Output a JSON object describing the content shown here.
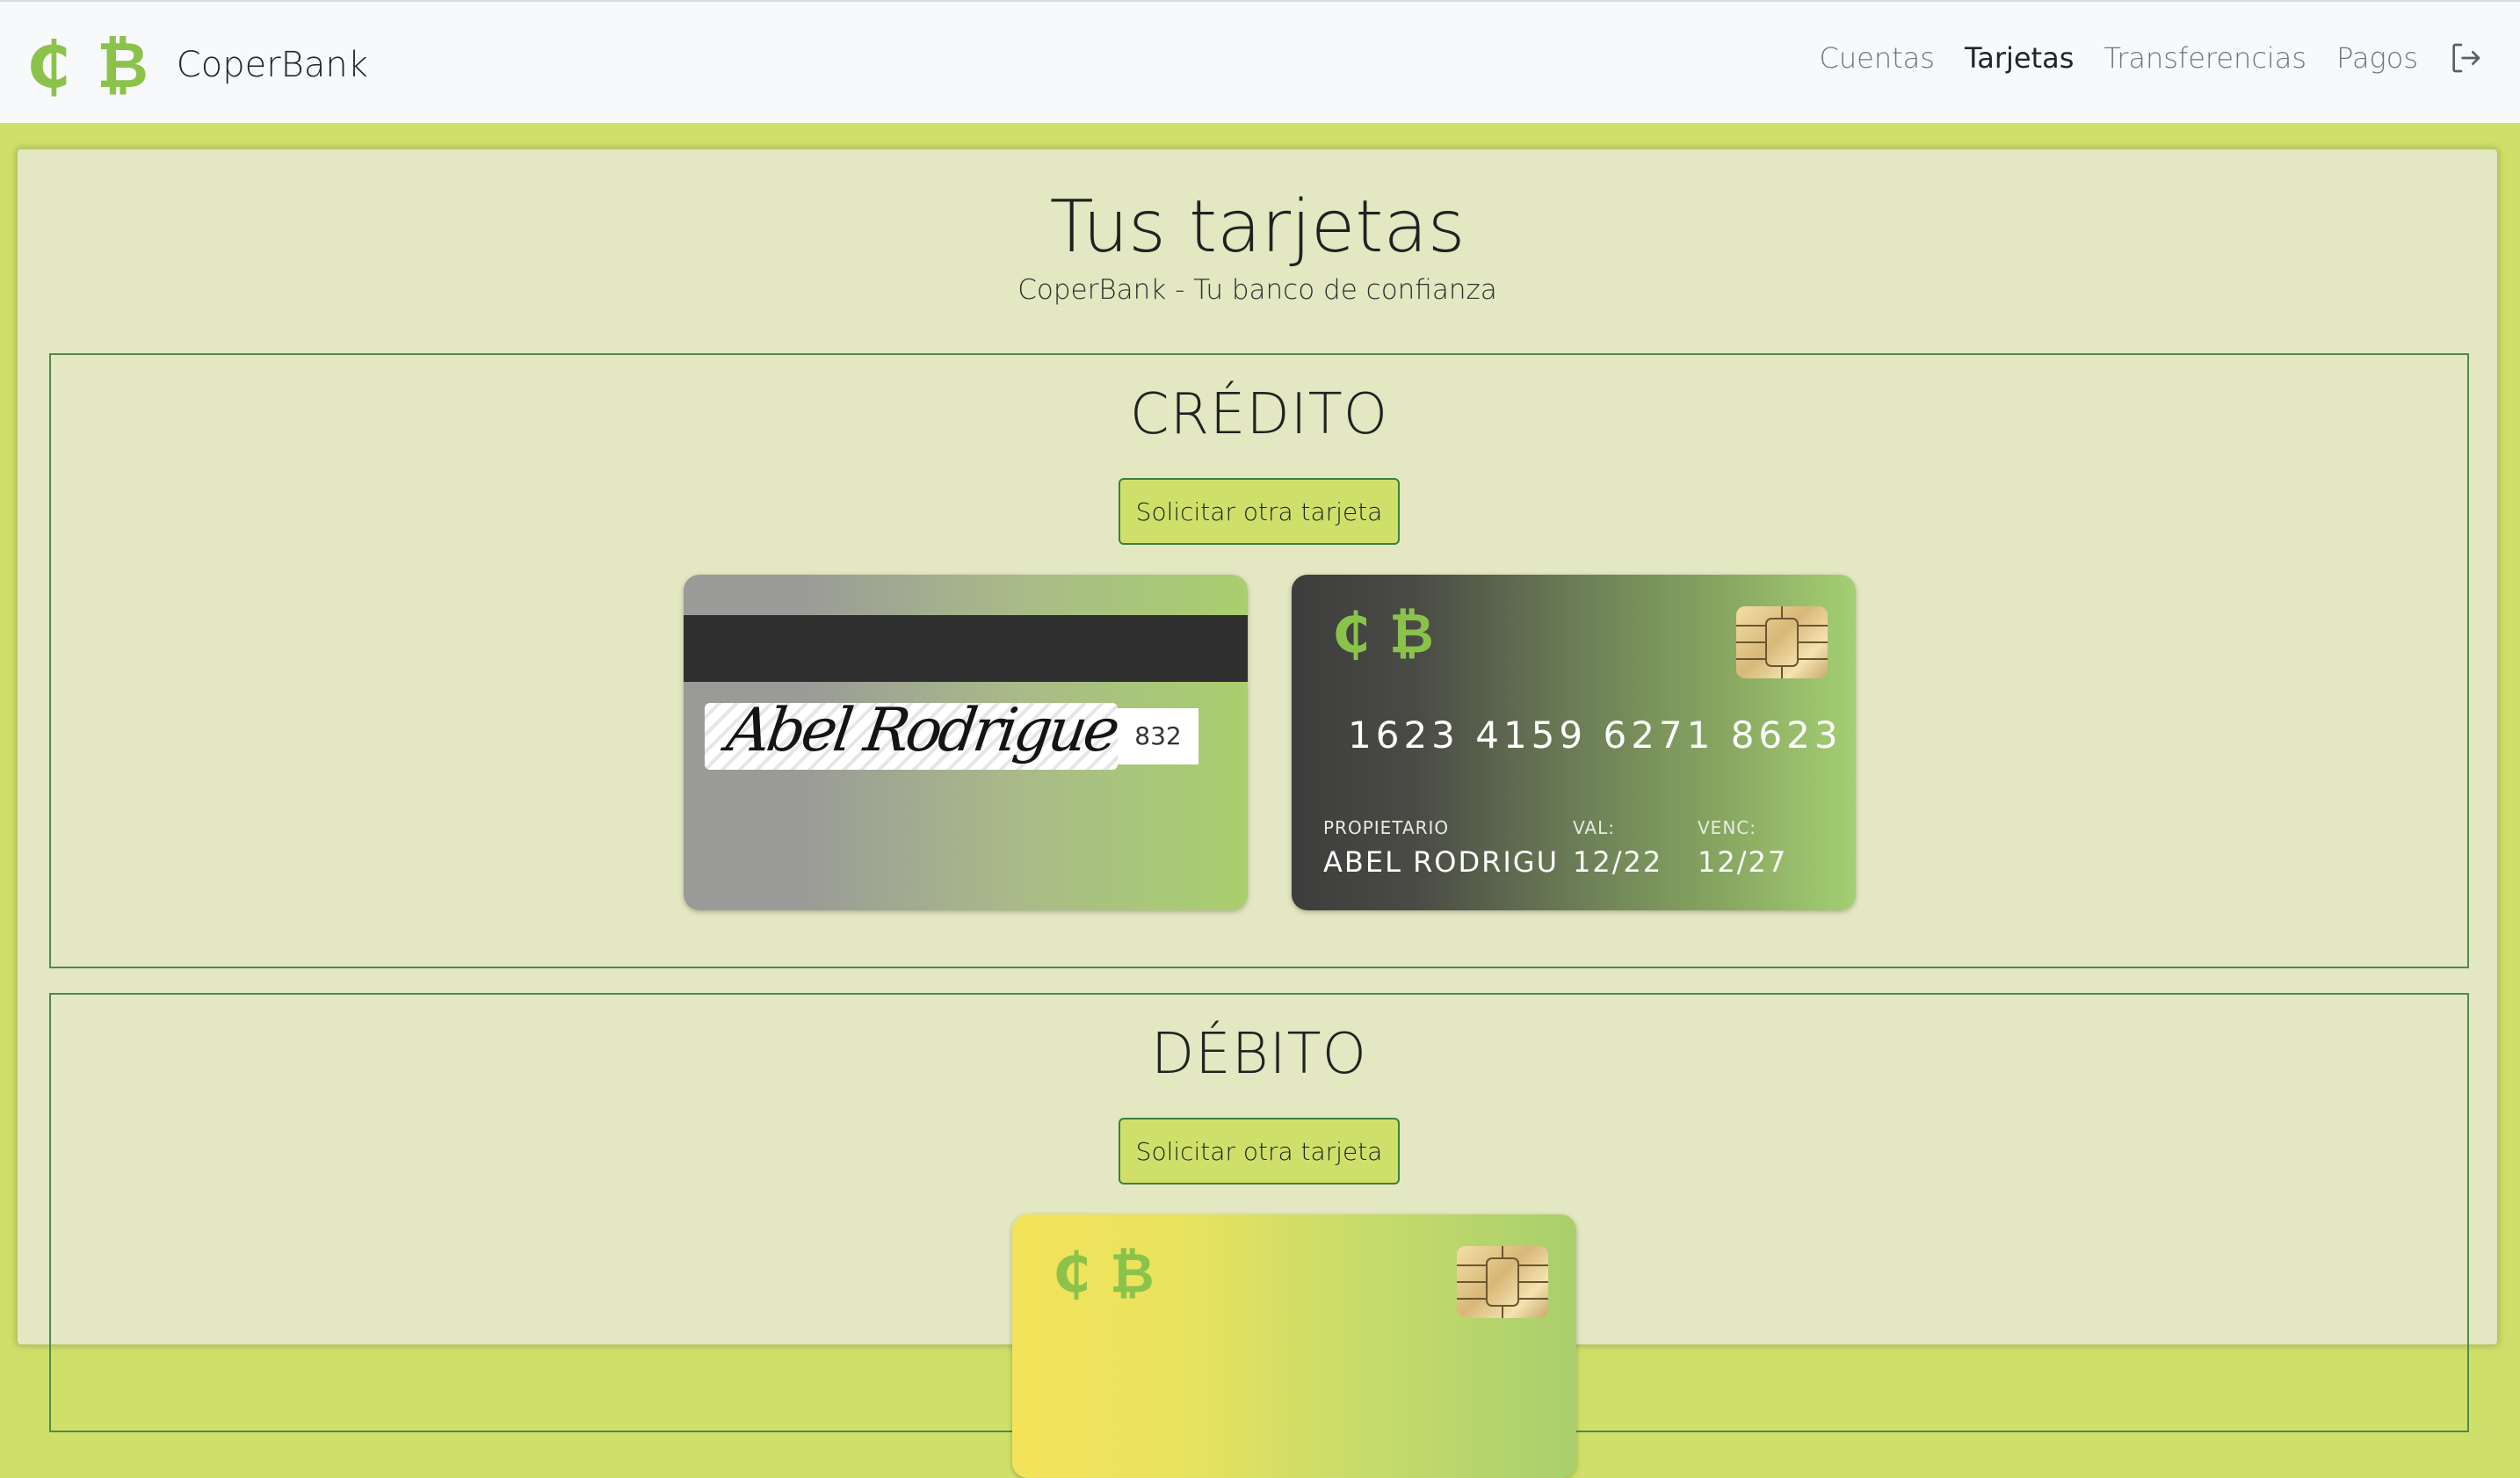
{
  "brand": {
    "name": "CoperBank",
    "icons": [
      "cedi-icon",
      "bitcoin-icon"
    ],
    "icon_glyphs": [
      "₵",
      "₿"
    ],
    "accent_color": "#8bc34a"
  },
  "nav": {
    "links": [
      {
        "label": "Cuentas",
        "active": false
      },
      {
        "label": "Tarjetas",
        "active": true
      },
      {
        "label": "Transferencias",
        "active": false
      },
      {
        "label": "Pagos",
        "active": false
      }
    ],
    "logout_icon": "logout-icon"
  },
  "page": {
    "title": "Tus tarjetas",
    "subtitle": "CoperBank - Tu banco de confianza"
  },
  "sections": {
    "credit": {
      "title": "CRÉDITO",
      "button_label": "Solicitar otra tarjeta",
      "card_back": {
        "signature": "Abel Rodrigue",
        "cvv": "832"
      },
      "card_front": {
        "number": "1623 4159 6271 8623",
        "owner_label": "PROPIETARIO",
        "owner": "ABEL RODRIGU",
        "valid_label": "VAL:",
        "valid": "12/22",
        "expiry_label": "VENC:",
        "expiry": "12/27"
      }
    },
    "debit": {
      "title": "DÉBITO",
      "button_label": "Solicitar otra tarjeta"
    }
  },
  "colors": {
    "page_bg": "#cfe06a",
    "panel_bg": "#e3e7c2",
    "section_border": "#4f8a4d",
    "button_bg": "#cfe06a"
  }
}
